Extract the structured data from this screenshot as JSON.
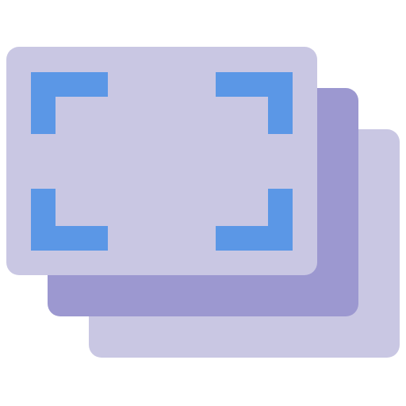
{
  "icon": {
    "name": "image-gallery-fullscreen-icon",
    "layers": [
      {
        "name": "back-card",
        "color": "#c9c7e3"
      },
      {
        "name": "middle-card",
        "color": "#9c98d0"
      },
      {
        "name": "front-card",
        "color": "#c9c7e3"
      }
    ],
    "corner_brackets": {
      "color": "#5b97e6"
    }
  }
}
